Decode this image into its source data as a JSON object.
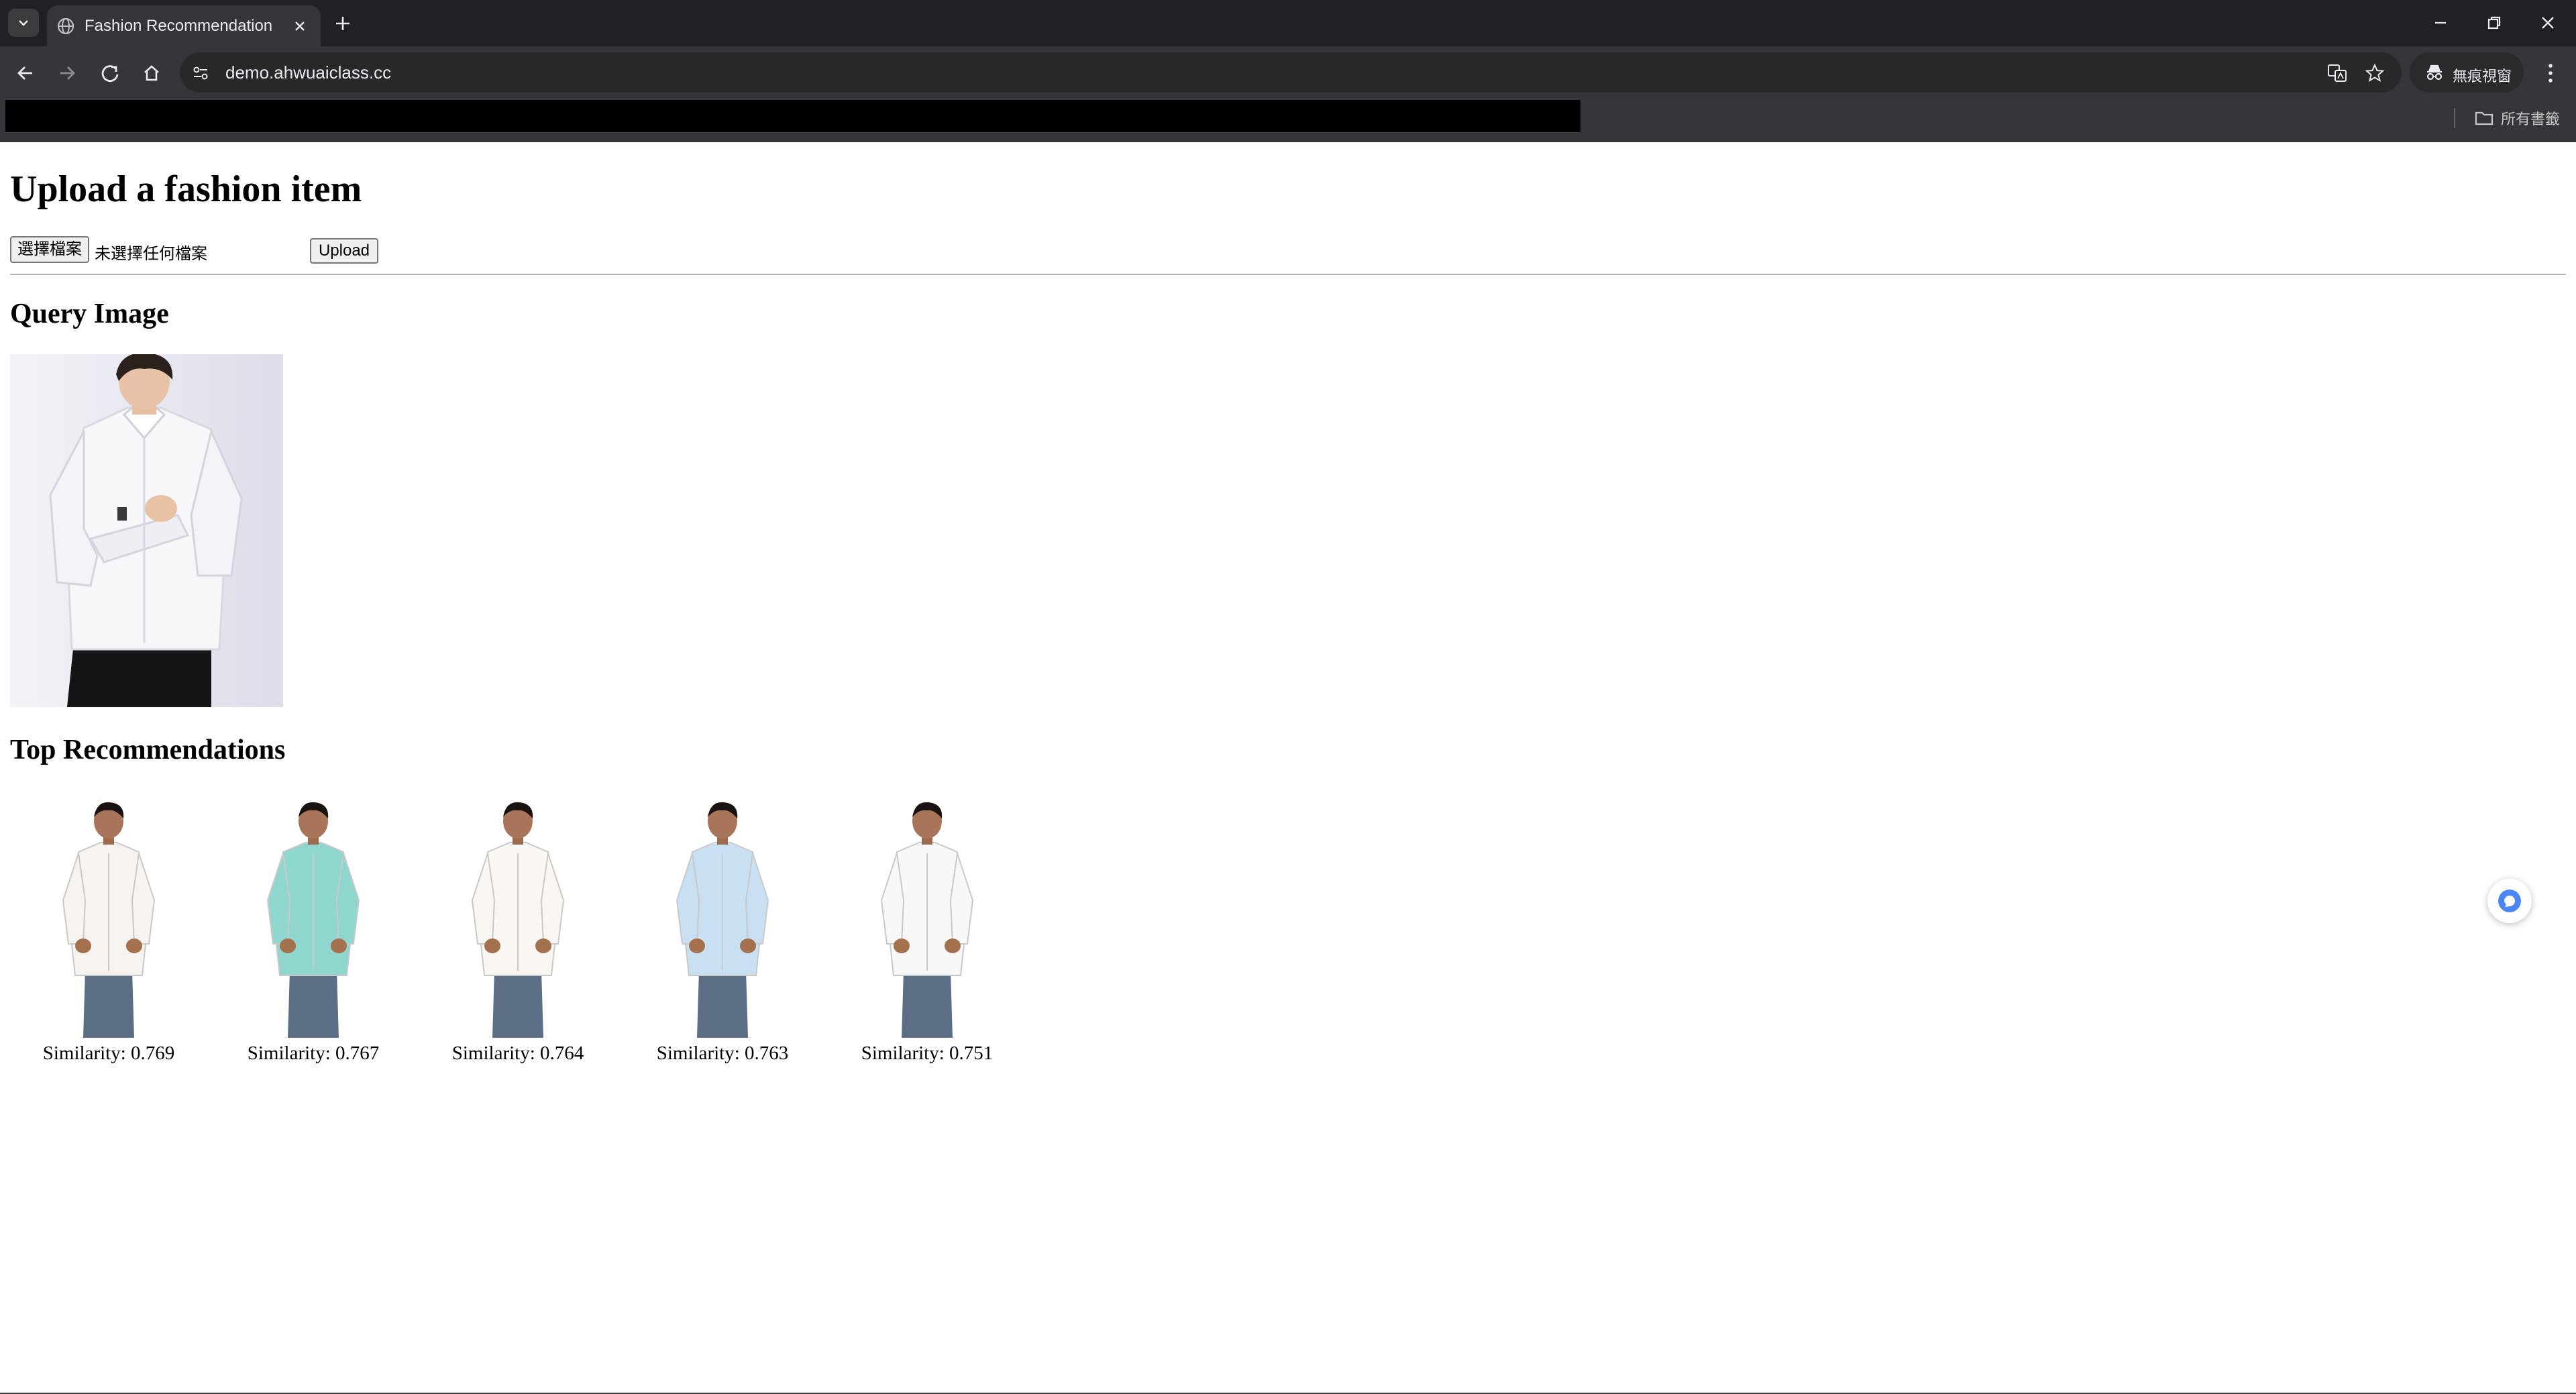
{
  "browser": {
    "tab": {
      "title": "Fashion Recommendation"
    },
    "address_bar": {
      "url": "demo.ahwuaiclass.cc"
    },
    "incognito_label": "無痕視窗",
    "bookmarks": {
      "all_bookmarks_label": "所有書籤"
    }
  },
  "page": {
    "heading": "Upload a fashion item",
    "file_input": {
      "button_label": "選擇檔案",
      "status_text": "未選擇任何檔案"
    },
    "upload_button": "Upload",
    "query_heading": "Query Image",
    "recommendations_heading": "Top Recommendations",
    "recommendations": [
      {
        "caption": "Similarity: 0.769",
        "shirt_color": "#f6f3f1"
      },
      {
        "caption": "Similarity: 0.767",
        "shirt_color": "#8fd6cf"
      },
      {
        "caption": "Similarity: 0.764",
        "shirt_color": "#faf6f2"
      },
      {
        "caption": "Similarity: 0.763",
        "shirt_color": "#c9dff2"
      },
      {
        "caption": "Similarity: 0.751",
        "shirt_color": "#f8f8f8"
      }
    ]
  },
  "colors": {
    "chrome_dark": "#202124",
    "chrome_toolbar": "#35363a",
    "accent_blue": "#4a86f5"
  }
}
